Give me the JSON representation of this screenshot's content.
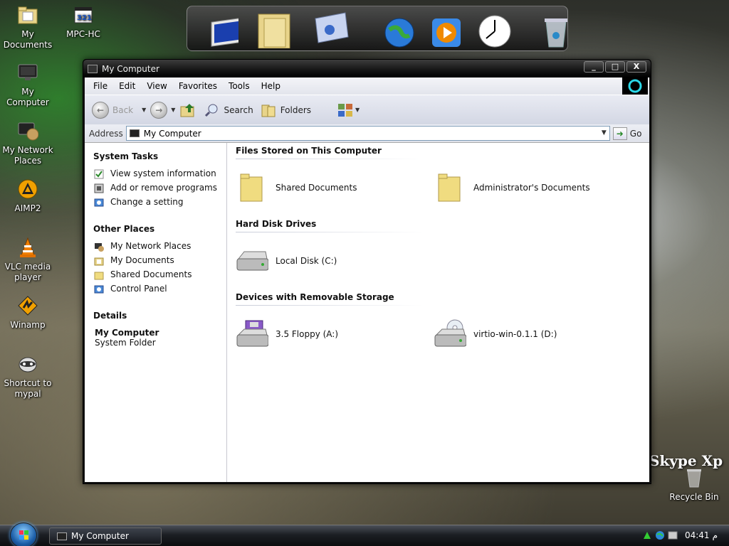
{
  "desktop_icons": [
    {
      "label": "My Documents",
      "icon": "folder-docs-icon"
    },
    {
      "label": "My Computer",
      "icon": "computer-icon"
    },
    {
      "label": "My Network Places",
      "icon": "network-icon"
    },
    {
      "label": "AIMP2",
      "icon": "aimp-icon"
    },
    {
      "label": "VLC media player",
      "icon": "vlc-cone-icon"
    },
    {
      "label": "Winamp",
      "icon": "winamp-icon"
    },
    {
      "label": "Shortcut to mypal",
      "icon": "raccoon-icon"
    },
    {
      "label": "MPC-HC",
      "icon": "mpc-icon"
    },
    {
      "label": "Recycle Bin",
      "icon": "recycle-bin-icon"
    }
  ],
  "overlay_text": "Skype Xp",
  "window": {
    "title": "My Computer",
    "controls": {
      "minimize": "_",
      "maximize": "□",
      "close": "X"
    }
  },
  "menu": [
    "File",
    "Edit",
    "View",
    "Favorites",
    "Tools",
    "Help"
  ],
  "toolbar": {
    "back": "Back",
    "search": "Search",
    "folders": "Folders"
  },
  "address": {
    "label": "Address",
    "value": "My Computer",
    "go": "Go"
  },
  "sidebar": {
    "system_tasks": {
      "title": "System Tasks",
      "items": [
        "View system information",
        "Add or remove programs",
        "Change a setting"
      ]
    },
    "other_places": {
      "title": "Other Places",
      "items": [
        "My Network Places",
        "My Documents",
        "Shared Documents",
        "Control Panel"
      ]
    },
    "details": {
      "title": "Details",
      "name": "My Computer",
      "type": "System Folder"
    }
  },
  "groups": [
    {
      "title": "Files Stored on This Computer",
      "items": [
        "Shared Documents",
        "Administrator's Documents"
      ]
    },
    {
      "title": "Hard Disk Drives",
      "items": [
        "Local Disk (C:)"
      ]
    },
    {
      "title": "Devices with Removable Storage",
      "items": [
        "3.5 Floppy (A:)",
        "virtio-win-0.1.1 (D:)"
      ]
    }
  ],
  "taskbar": {
    "task_label": "My Computer",
    "clock": "04:41",
    "clock_suffix": "م"
  }
}
